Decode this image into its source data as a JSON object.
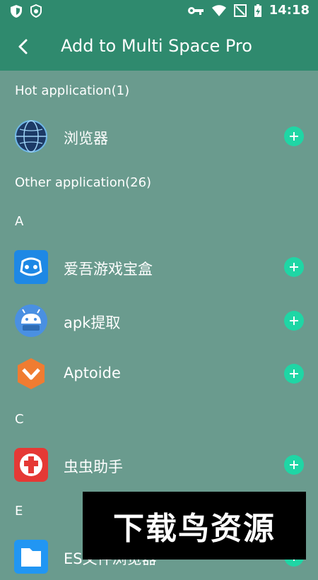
{
  "status_bar": {
    "time": "14:18",
    "icons_left": [
      "shield-icon",
      "badge-icon"
    ],
    "icons_right": [
      "key-icon",
      "wifi-icon",
      "no-sim-icon",
      "battery-charging-icon"
    ]
  },
  "app_bar": {
    "title": "Add to Multi Space Pro",
    "back_icon": "back-arrow-icon"
  },
  "sections": [
    {
      "label": "Hot application(1)"
    },
    {
      "label": "Other application(26)"
    },
    {
      "label": "A"
    },
    {
      "label": "C"
    },
    {
      "label": "E"
    }
  ],
  "apps": [
    {
      "name": "浏览器",
      "icon": "globe-icon"
    },
    {
      "name": "爱吾游戏宝盒",
      "icon": "game-box-icon"
    },
    {
      "name": "apk提取",
      "icon": "android-apk-icon"
    },
    {
      "name": "Aptoide",
      "icon": "aptoide-icon"
    },
    {
      "name": "虫虫助手",
      "icon": "chongchong-icon"
    },
    {
      "name": "ES文件浏览器",
      "icon": "es-file-icon"
    }
  ],
  "watermark": {
    "text": "下载鸟资源"
  },
  "colors": {
    "appbar": "#2f8a6e",
    "background": "#6a9b8e",
    "accent": "#1fd6a5"
  }
}
